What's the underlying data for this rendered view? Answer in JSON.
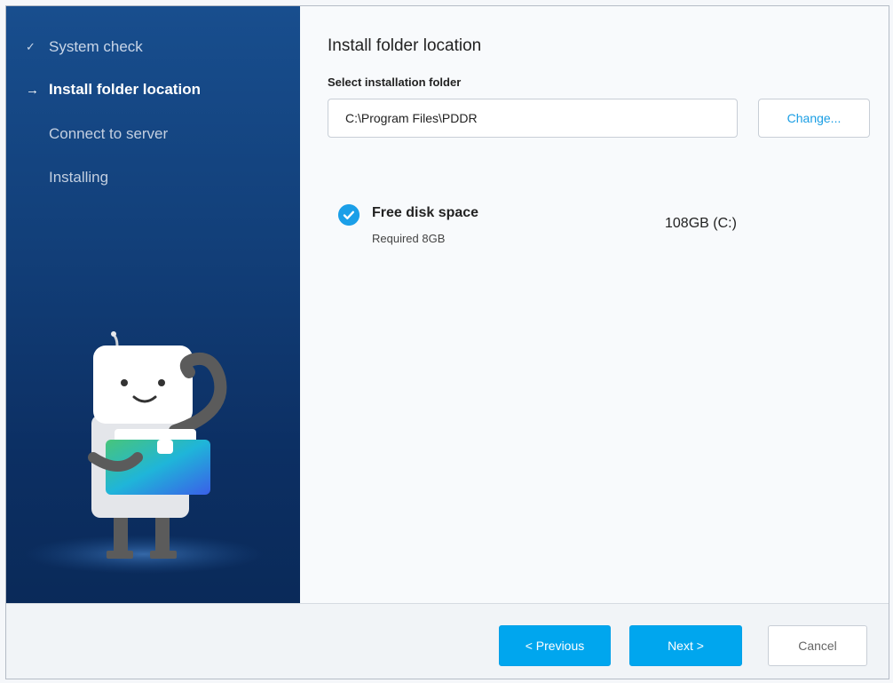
{
  "sidebar": {
    "steps": [
      {
        "label": "System check",
        "status": "completed"
      },
      {
        "label": "Install folder location",
        "status": "active"
      },
      {
        "label": "Connect to server",
        "status": "pending"
      },
      {
        "label": "Installing",
        "status": "pending"
      }
    ],
    "icons": {
      "completed": "✓",
      "active": "→"
    }
  },
  "main": {
    "title": "Install folder location",
    "folder_label": "Select installation folder",
    "folder_value": "C:\\Program Files\\PDDR",
    "change_label": "Change...",
    "disk": {
      "title": "Free disk space",
      "required": "Required 8GB",
      "value": "108GB (C:)",
      "status_icon": "check-circle-icon"
    }
  },
  "footer": {
    "previous_label": "< Previous",
    "next_label": "Next >",
    "cancel_label": "Cancel"
  },
  "colors": {
    "accent": "#00a6ee",
    "sidebar_top": "#184e8e",
    "sidebar_bottom": "#0a2a59"
  }
}
